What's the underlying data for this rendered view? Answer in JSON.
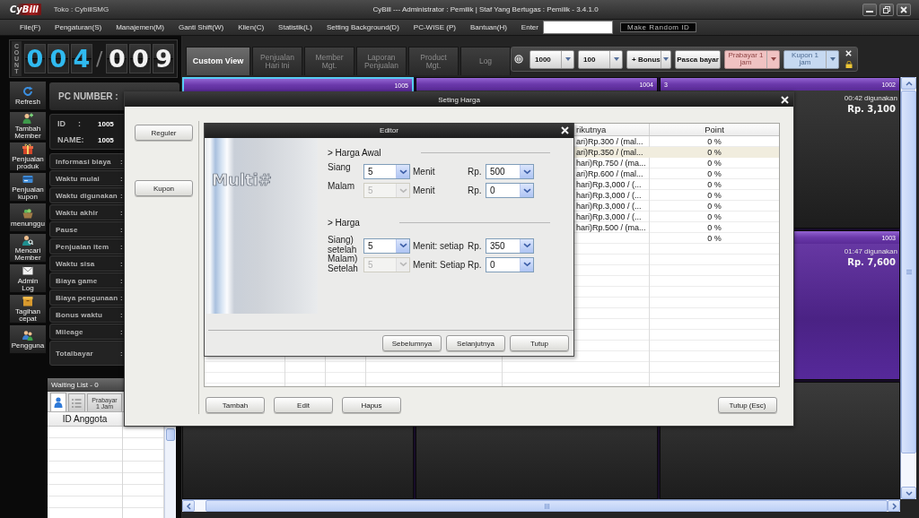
{
  "window": {
    "logo": "CyBill",
    "store": "Toko : CybillSMG",
    "title": "CyBill --- Administrator : Pemilik | Staf Yang Bertugas : Pemilik - 3.4.1.0"
  },
  "menu": {
    "items": [
      "File(F)",
      "Pengaturan(S)",
      "Manajemen(M)",
      "Ganti Shift(W)",
      "Klien(C)",
      "Statistik(L)",
      "Setting Background(D)",
      "PC-WISE (P)",
      "Bantuan(H)"
    ],
    "enter_label": "Enter",
    "random_id_button": "Make Random ID"
  },
  "counter": {
    "label": "COUNT",
    "used": [
      "0",
      "0",
      "4"
    ],
    "separator": "/",
    "total": [
      "0",
      "0",
      "9"
    ]
  },
  "sidebar": {
    "items": [
      {
        "label": "Refresh"
      },
      {
        "label": "Tambah Member"
      },
      {
        "label": "Penjualan produk"
      },
      {
        "label": "Penjualan kupon"
      },
      {
        "label": "menunggu"
      },
      {
        "label": "Mencari Member"
      },
      {
        "label": "Admin Log"
      },
      {
        "label": "Tagihan cepat"
      },
      {
        "label": "Pengguna"
      }
    ]
  },
  "pc_info": {
    "header": "PC NUMBER :",
    "id": {
      "label": "ID",
      "colon": ":",
      "value": "1005"
    },
    "name": {
      "label": "NAME:",
      "value": "1005"
    },
    "rows": [
      {
        "kind": "detail",
        "label": "Informasi biaya",
        "colon": ":"
      },
      {
        "kind": "detail",
        "label": "Waktu mulai",
        "colon": ":"
      },
      {
        "kind": "detail",
        "label": "Waktu digunakan",
        "colon": ":"
      },
      {
        "kind": "detail",
        "label": "Waktu akhir",
        "colon": ":"
      },
      {
        "kind": "detail",
        "label": "Pause",
        "colon": ":"
      },
      {
        "kind": "detail",
        "label": "Penjualan item",
        "colon": ":"
      },
      {
        "kind": "detail",
        "label": "Waktu sisa",
        "colon": ":"
      },
      {
        "kind": "detail",
        "label": "Biaya game",
        "colon": ":"
      },
      {
        "kind": "detail",
        "label": "Biaya pengunaan",
        "colon": ":"
      },
      {
        "kind": "detail",
        "label": "Bonus waktu",
        "colon": ":"
      },
      {
        "kind": "detail",
        "label": "Mileage",
        "colon": ":"
      },
      {
        "kind": "total",
        "label": "Totalbayar",
        "colon": ":"
      }
    ]
  },
  "waiting_list": {
    "title": "Waiting List - 0",
    "tabs": [
      {
        "kind": "icon",
        "selected": true
      },
      {
        "kind": "icon",
        "selected": false
      },
      {
        "kind": "text",
        "label": "Prabayar 1 Jam",
        "selected": false
      }
    ],
    "columns": [
      "ID Anggota"
    ]
  },
  "view_tabs": [
    {
      "label": "Custom View",
      "selected": true
    },
    {
      "label": "Penjualan Hari Ini",
      "selected": false
    },
    {
      "label": "Member Mgt.",
      "selected": false
    },
    {
      "label": "Laporan Penjualan",
      "selected": false
    },
    {
      "label": "Product Mgt.",
      "selected": false
    },
    {
      "label": "Log",
      "selected": false
    }
  ],
  "price_toolbar": {
    "items": [
      {
        "kind": "dropdown",
        "label": "1000"
      },
      {
        "kind": "dropdown",
        "label": "100"
      },
      {
        "kind": "dropdown",
        "label": "+ Bonus"
      },
      {
        "kind": "button",
        "label": "Pasca bayar"
      },
      {
        "kind": "split",
        "label": "Prabayar 1 jam",
        "color": "#f0c2c2"
      },
      {
        "kind": "split",
        "label": "Kupon 1 jam",
        "color": "#c6d9f1"
      }
    ]
  },
  "pc_grid": {
    "rows": [
      {
        "tiles": [
          {
            "kind": "active",
            "selected": true,
            "number": "1005"
          },
          {
            "kind": "active",
            "selected": false,
            "number": "1004"
          },
          {
            "kind": "active",
            "selected": false,
            "tag": "3",
            "number": "1002",
            "usage": "00:42 digunakan",
            "cost": "Rp. 3,100"
          }
        ]
      },
      {
        "tiles": [
          {
            "kind": "active-fill",
            "selected": false,
            "number": "1003",
            "usage": "01:47 digunakan",
            "cost": "Rp. 7,600"
          }
        ]
      },
      {
        "tiles": [
          {
            "selected": false
          },
          {
            "selected": false
          },
          {
            "selected": false
          }
        ]
      }
    ]
  },
  "price_dialog": {
    "title": "Seting Harga",
    "categories": [
      "Reguler",
      "Kupon"
    ],
    "table": {
      "columns": [
        "rikutnya",
        "Point"
      ],
      "rows": [
        {
          "rate": "ari)Rp.300 / (mal...",
          "point": "0 %",
          "selected": false
        },
        {
          "rate": "ari)Rp.350 / (mal...",
          "point": "0 %",
          "selected": true
        },
        {
          "rate": "hari)Rp.750 / (ma...",
          "point": "0 %",
          "selected": false
        },
        {
          "rate": "ari)Rp.600 / (mal...",
          "point": "0 %",
          "selected": false
        },
        {
          "rate": "hari)Rp.3,000 / (...",
          "point": "0 %",
          "selected": false
        },
        {
          "rate": "hari)Rp.3,000 / (...",
          "point": "0 %",
          "selected": false
        },
        {
          "rate": "hari)Rp.3,000 / (...",
          "point": "0 %",
          "selected": false
        },
        {
          "rate": "hari)Rp.3,000 / (...",
          "point": "0 %",
          "selected": false
        },
        {
          "rate": "hari)Rp.500 / (ma...",
          "point": "0 %",
          "selected": false
        },
        {
          "point": "0 %",
          "selected": false
        }
      ]
    },
    "buttons": [
      "Tambah",
      "Edit",
      "Hapus"
    ],
    "close_button": "Tutup (Esc)"
  },
  "editor": {
    "title": "Editor",
    "logo": "Multi#",
    "sections": [
      {
        "heading": "> Harga Awal",
        "rows": [
          {
            "label": "Siang",
            "minutes": {
              "value": "5",
              "disabled": false
            },
            "unit": "Menit",
            "currency": "Rp.",
            "price": {
              "value": "500",
              "disabled": false
            }
          },
          {
            "label": "Malam",
            "minutes": {
              "value": "5",
              "disabled": true
            },
            "unit": "Menit",
            "currency": "Rp.",
            "price": {
              "value": "0",
              "disabled": false
            }
          }
        ]
      },
      {
        "heading": "> Harga",
        "rows": [
          {
            "label": "Siang) setelah",
            "minutes": {
              "value": "5",
              "disabled": false
            },
            "unit": "Menit: setiap",
            "currency": "Rp.",
            "price": {
              "value": "350",
              "disabled": false
            }
          },
          {
            "label": "Malam) Setelah",
            "minutes": {
              "value": "5",
              "disabled": true
            },
            "unit": "Menit: Setiap",
            "currency": "Rp.",
            "price": {
              "value": "0",
              "disabled": false
            }
          }
        ]
      }
    ],
    "buttons": [
      "Sebelumnya",
      "Selanjutnya",
      "Tutup"
    ]
  }
}
